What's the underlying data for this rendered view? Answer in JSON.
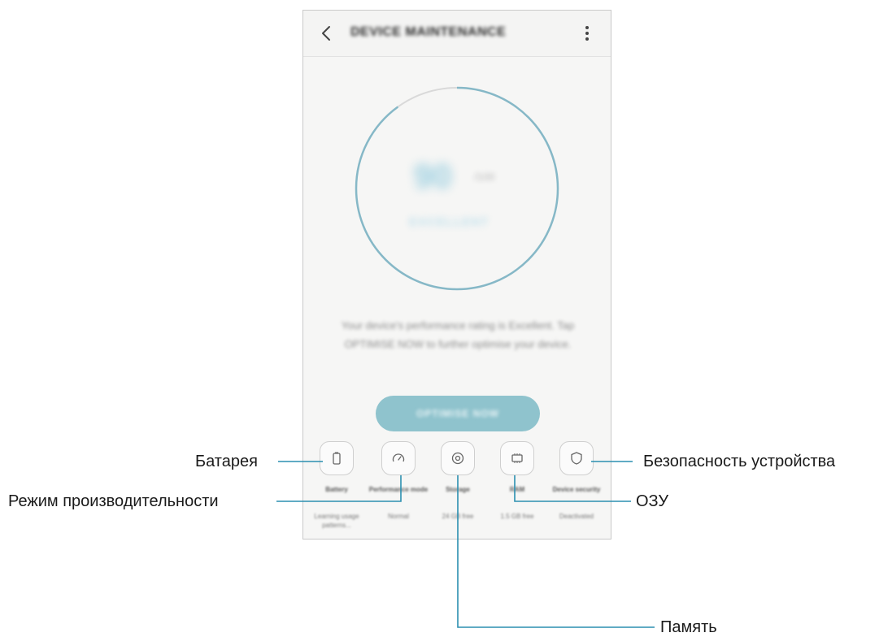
{
  "app": {
    "title": "DEVICE MAINTENANCE",
    "back_icon": "chevron-left-icon",
    "more_icon": "more-vert-icon"
  },
  "gauge": {
    "score": "90",
    "unit": "/100",
    "label": "EXCELLENT",
    "progress": 0.9,
    "ring_color": "#86b8c7",
    "track_color": "#d9d9d9"
  },
  "description": "Your device's performance rating is Excellent. Tap OPTIMISE NOW to further optimise your device.",
  "optimise_button": {
    "label": "OPTIMISE NOW",
    "color": "#8fc3cd"
  },
  "tools": [
    {
      "name": "Battery",
      "value": "Learning usage patterns...",
      "icon": "battery-icon"
    },
    {
      "name": "Performance mode",
      "value": "Normal",
      "icon": "speedometer-icon"
    },
    {
      "name": "Storage",
      "value": "24 GB free",
      "icon": "storage-icon"
    },
    {
      "name": "RAM",
      "value": "1.5 GB free",
      "icon": "ram-chip-icon"
    },
    {
      "name": "Device security",
      "value": "Deactivated",
      "icon": "shield-icon"
    }
  ],
  "callouts": {
    "battery": "Батарея",
    "performance": "Режим производительности",
    "storage": "Память",
    "ram": "ОЗУ",
    "security": "Безопасность устройства"
  }
}
